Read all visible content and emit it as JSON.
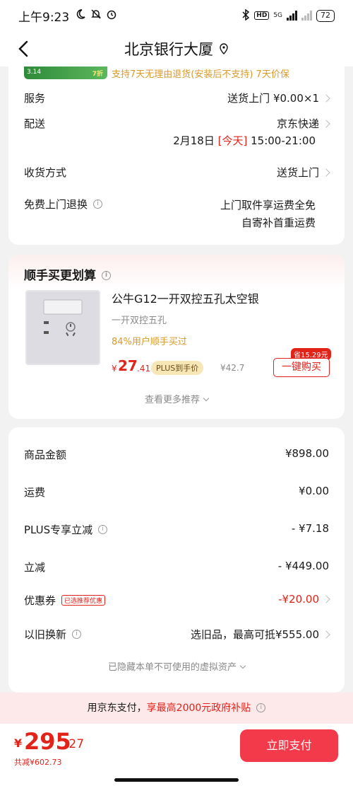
{
  "status_bar": {
    "time": "上午9:23",
    "hd_badge": "HD",
    "net_label": "5G",
    "battery": "72"
  },
  "nav": {
    "title": "北京银行大厦"
  },
  "delivery_card": {
    "promo_badge_left": "3.14",
    "promo_badge_right": "7折",
    "promo_text": "支持7天无理由退货(安装后不支持) 7天价保",
    "service_label": "服务",
    "service_value": "送货上门 ¥0.00×1",
    "shipping_label": "配送",
    "shipping_value": "京东快递",
    "shipping_date": "2月18日",
    "shipping_today": "[今天]",
    "shipping_time": "15:00-21:00",
    "receive_label": "收货方式",
    "receive_value": "送货上门",
    "return_label": "免费上门退换",
    "return_value_1": "上门取件享运费全免",
    "return_value_2": "自寄补首重运费"
  },
  "addon_card": {
    "title": "顺手买更划算",
    "product": {
      "name": "公牛G12一开双控五孔太空银",
      "spec": "一开双控五孔",
      "rate": "84%用户顺手买过",
      "price_symbol": "¥",
      "price_int": "27",
      "price_dec": ".41",
      "plus_tag": "PLUS到手价",
      "orig_price": "¥42.7",
      "save_tag": "省15.29元",
      "buy_label": "一键购买"
    },
    "more_label": "查看更多推荐"
  },
  "summary_card": {
    "rows": [
      {
        "label": "商品金额",
        "value": "¥898.00"
      },
      {
        "label": "运费",
        "value": "¥0.00"
      },
      {
        "label": "PLUS专享立减",
        "value": "- ¥7.18"
      },
      {
        "label": "立减",
        "value": "- ¥449.00"
      },
      {
        "label": "优惠券",
        "tag": "已选推荐优惠",
        "value": "-¥20.00"
      },
      {
        "label": "以旧换新",
        "value": "选旧品，最高可抵¥555.00"
      }
    ],
    "hidden_assets": "已隐藏本单不可使用的虚拟资产"
  },
  "subsidy_banner": {
    "prefix": "用京东支付，",
    "highlight": "享最高2000元政府补贴"
  },
  "bottom_bar": {
    "total_symbol": "¥",
    "total_int": "295",
    "total_dec": ".27",
    "discount": "共减¥602.73",
    "pay_label": "立即支付"
  },
  "colors": {
    "accent_red": "#e2231a",
    "pay_button": "#f23a4a",
    "gold_text": "#d99a2b"
  }
}
